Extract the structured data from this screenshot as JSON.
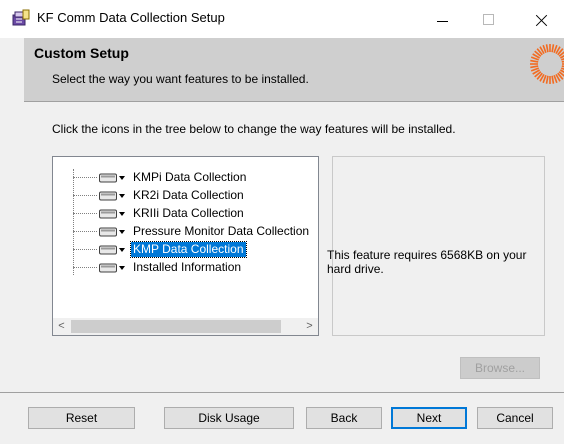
{
  "window": {
    "title": "KF Comm Data Collection Setup",
    "icon": "installer-package-icon"
  },
  "banner": {
    "title": "Custom Setup",
    "subtitle": "Select the way you want features to be installed.",
    "logo_icon": "sun-ring-logo"
  },
  "instruction": "Click the icons in the tree below to change the way features will be installed.",
  "tree": {
    "items": [
      {
        "label": "KMPi Data Collection",
        "selected": false
      },
      {
        "label": "KR2i Data Collection",
        "selected": false
      },
      {
        "label": "KRIIi Data Collection",
        "selected": false
      },
      {
        "label": "Pressure Monitor Data Collection",
        "selected": false
      },
      {
        "label": "KMP Data Collection",
        "selected": true
      },
      {
        "label": "Installed Information",
        "selected": false
      }
    ],
    "scroll_left": "<",
    "scroll_right": ">"
  },
  "feature_info": "This feature requires 6568KB on your hard drive.",
  "buttons": {
    "browse": "Browse...",
    "reset": "Reset",
    "disk_usage": "Disk Usage",
    "back": "Back",
    "next": "Next",
    "cancel": "Cancel"
  },
  "colors": {
    "selection": "#0078d7",
    "banner_bg": "#cfcfcf",
    "logo_orange": "#f26b21"
  }
}
